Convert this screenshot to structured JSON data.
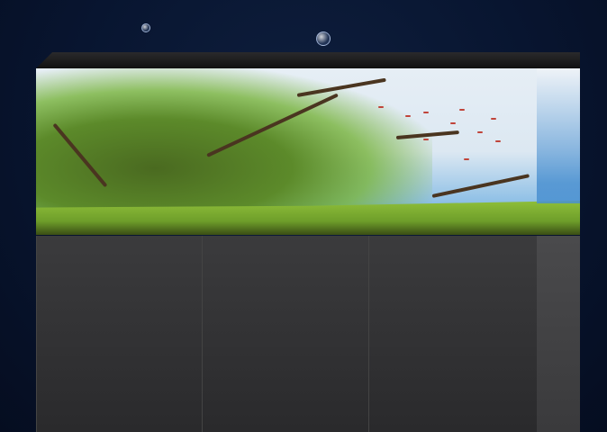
{
  "image": {
    "subject": "aquarium-with-cabinet",
    "background_color": "#081530",
    "cabinet_color": "#333335",
    "water_color": "#2e7fcf",
    "plant_color": "#5c8a2a"
  }
}
